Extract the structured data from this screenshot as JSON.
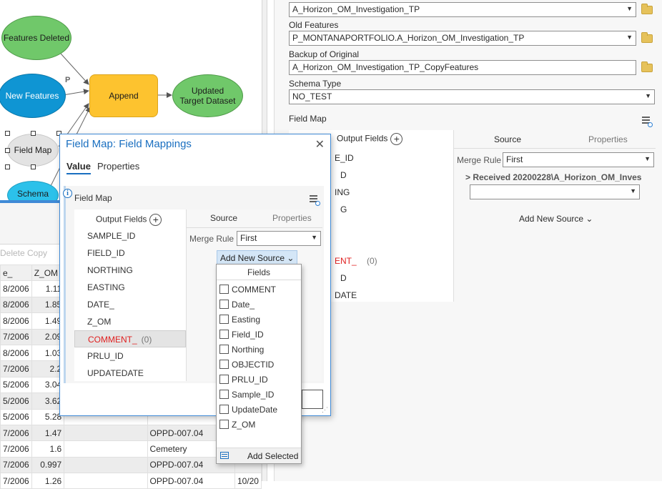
{
  "model": {
    "features_deleted": "Features Deleted",
    "new_features": "New Features",
    "append": "Append",
    "updated_target": "Updated Target Dataset",
    "field_map": "Field Map",
    "schema": "Schema",
    "p_label": "P"
  },
  "toolbar": {
    "delete": "Delete",
    "copy": "Copy"
  },
  "table": {
    "headers": [
      "e_",
      "Z_OM"
    ],
    "rows": [
      [
        "8/2006",
        "1.11",
        "",
        "",
        ""
      ],
      [
        "8/2006",
        "1.85",
        "",
        "",
        ""
      ],
      [
        "8/2006",
        "1.49",
        "",
        "",
        ""
      ],
      [
        "7/2006",
        "2.09",
        "",
        "",
        ""
      ],
      [
        "8/2006",
        "1.03",
        "",
        "",
        ""
      ],
      [
        "7/2006",
        "2.2",
        "",
        "",
        ""
      ],
      [
        "5/2006",
        "3.04",
        "",
        "",
        ""
      ],
      [
        "5/2006",
        "3.62",
        "",
        "",
        ""
      ],
      [
        "5/2006",
        "5.28",
        "",
        "",
        ""
      ],
      [
        "7/2006",
        "1.47",
        "",
        "OPPD-007.04",
        ""
      ],
      [
        "7/2006",
        "1.6",
        "",
        "Cemetery",
        ""
      ],
      [
        "7/2006",
        "0.997",
        "",
        "OPPD-007.04",
        ""
      ],
      [
        "7/2006",
        "1.26",
        "",
        "OPPD-007.04",
        "10/20"
      ]
    ]
  },
  "right_pane": {
    "target_value": "A_Horizon_OM_Investigation_TP",
    "old_features_label": "Old Features",
    "old_features_value": "P_MONTANAPORTFOLIO.A_Horizon_OM_Investigation_TP",
    "backup_label": "Backup of Original",
    "backup_value": "A_Horizon_OM_Investigation_TP_CopyFeatures",
    "schema_label": "Schema Type",
    "schema_value": "NO_TEST",
    "field_map_label": "Field Map",
    "output_fields": "Output Fields",
    "source_tab": "Source",
    "properties_tab": "Properties",
    "merge_rule_label": "Merge Rule",
    "merge_rule_value": "First",
    "received": "> Received 20200228\\A_Horizon_OM_Inves",
    "add_new_source": "Add New Source",
    "partial_fields": [
      "E_ID",
      "D",
      "ING",
      "G",
      "ENT_",
      "(0)",
      "D",
      "DATE"
    ]
  },
  "dialog": {
    "title": "Field Map: Field Mappings",
    "tab_value": "Value",
    "tab_properties": "Properties",
    "field_map_label": "Field Map",
    "output_fields": "Output Fields",
    "fields": [
      "SAMPLE_ID",
      "FIELD_ID",
      "NORTHING",
      "EASTING",
      "DATE_",
      "Z_OM",
      "COMMENT_",
      "PRLU_ID",
      "UPDATEDATE"
    ],
    "comment_count": "(0)",
    "source_tab": "Source",
    "properties_tab": "Properties",
    "merge_rule_label": "Merge Rule",
    "merge_rule_value": "First",
    "add_new_source": "Add New Source"
  },
  "dropdown": {
    "header": "Fields",
    "items": [
      "COMMENT",
      "Date_",
      "Easting",
      "Field_ID",
      "Northing",
      "OBJECTID",
      "PRLU_ID",
      "Sample_ID",
      "UpdateDate",
      "Z_OM"
    ],
    "add_selected": "Add Selected"
  },
  "icons": {
    "close": "close-icon",
    "info": "info-icon",
    "plus": "add-field-icon",
    "list": "field-map-list-icon",
    "folder": "folder-icon",
    "chevron": "chevron-down-icon"
  },
  "colors": {
    "accent": "#1a6fc0",
    "green_node": "#70c86a",
    "blue_node": "#0f95d3",
    "append_node": "#fdc32f",
    "error_text": "#e02020"
  }
}
